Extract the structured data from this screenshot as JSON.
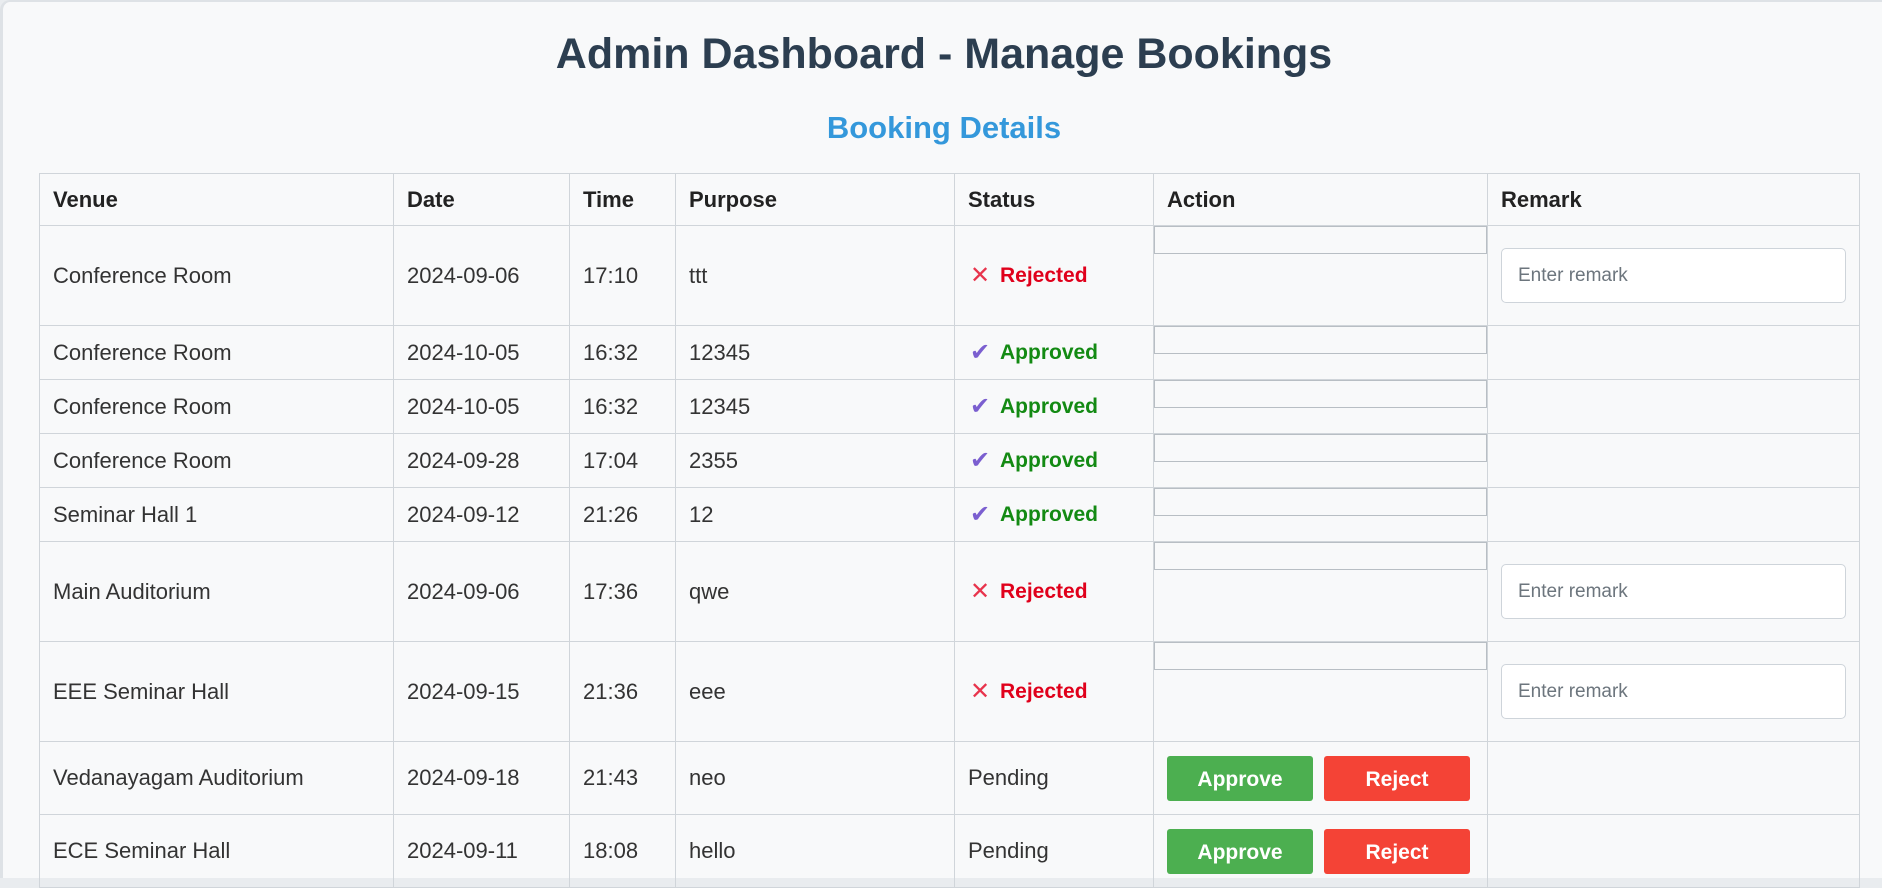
{
  "header": {
    "title": "Admin Dashboard - Manage Bookings",
    "subtitle": "Booking Details"
  },
  "table": {
    "columns": [
      "Venue",
      "Date",
      "Time",
      "Purpose",
      "Status",
      "Action",
      "Remark"
    ],
    "rows": [
      {
        "venue": "Conference Room",
        "date": "2024-09-06",
        "time": "17:10",
        "purpose": "ttt",
        "status": "Rejected"
      },
      {
        "venue": "Conference Room",
        "date": "2024-10-05",
        "time": "16:32",
        "purpose": "12345",
        "status": "Approved"
      },
      {
        "venue": "Conference Room",
        "date": "2024-10-05",
        "time": "16:32",
        "purpose": "12345",
        "status": "Approved"
      },
      {
        "venue": "Conference Room",
        "date": "2024-09-28",
        "time": "17:04",
        "purpose": "2355",
        "status": "Approved"
      },
      {
        "venue": "Seminar Hall 1",
        "date": "2024-09-12",
        "time": "21:26",
        "purpose": "12",
        "status": "Approved"
      },
      {
        "venue": "Main Auditorium",
        "date": "2024-09-06",
        "time": "17:36",
        "purpose": "qwe",
        "status": "Rejected"
      },
      {
        "venue": "EEE Seminar Hall",
        "date": "2024-09-15",
        "time": "21:36",
        "purpose": "eee",
        "status": "Rejected"
      },
      {
        "venue": "Vedanayagam Auditorium",
        "date": "2024-09-18",
        "time": "21:43",
        "purpose": "neo",
        "status": "Pending"
      },
      {
        "venue": "ECE Seminar Hall",
        "date": "2024-09-11",
        "time": "18:08",
        "purpose": "hello",
        "status": "Pending"
      }
    ]
  },
  "actions": {
    "approve_label": "Approve",
    "reject_label": "Reject"
  },
  "remark": {
    "placeholder": "Enter remark"
  },
  "icons": {
    "rejected": "x-icon",
    "approved": "checkmark-icon"
  },
  "colors": {
    "title": "#2c3e50",
    "subtitle": "#3498db",
    "approved_text": "#138a13",
    "rejected_text": "#e0001b",
    "approve_button": "#4caf50",
    "reject_button": "#f44336"
  }
}
